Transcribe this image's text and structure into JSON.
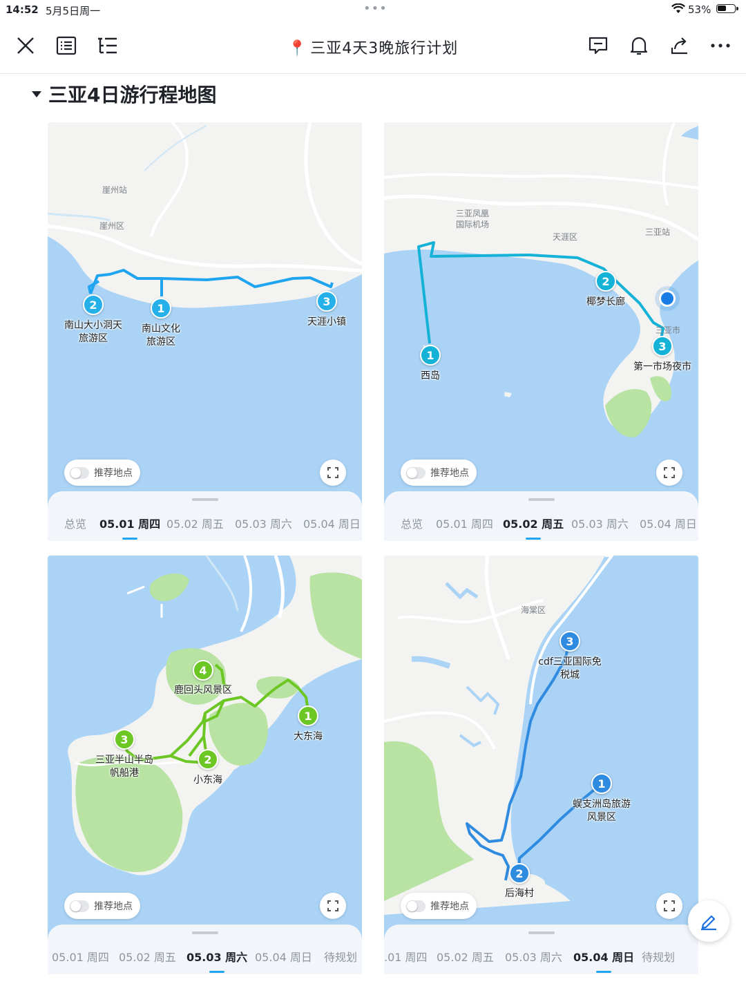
{
  "status_bar": {
    "time": "14:52",
    "date": "5月5日周一",
    "battery": "53%",
    "battery_level": 0.53
  },
  "toolbar": {
    "title": "三亚4天3晚旅行计划",
    "icons": [
      "close-icon",
      "outline-icon",
      "toc-icon",
      "comment-icon",
      "bell-icon",
      "share-icon",
      "more-icon"
    ]
  },
  "section": {
    "title": "三亚4日游行程地图"
  },
  "colors": {
    "water": "#aad3f5",
    "land": "#f3f3f1",
    "green": "#b8e3a2",
    "route_blue": "#25b0ea",
    "route_green": "#6cc623",
    "route_dblue": "#2f8be0",
    "accent": "#1fa5f0"
  },
  "maps": [
    {
      "recommend_label": "推荐地点",
      "tabs": [
        "总览",
        "05.01 周四",
        "05.02 周五",
        "05.03 周六",
        "05.04 周日"
      ],
      "active_tab": 1,
      "areas": [
        "崖州站",
        "崖州区"
      ],
      "markers": [
        {
          "num": "2",
          "name": "南山大小洞天\n旅游区"
        },
        {
          "num": "1",
          "name": "南山文化\n旅游区"
        },
        {
          "num": "3",
          "name": "天涯小镇"
        }
      ]
    },
    {
      "recommend_label": "推荐地点",
      "tabs": [
        "总览",
        "05.01 周四",
        "05.02 周五",
        "05.03 周六",
        "05.04 周日"
      ],
      "active_tab": 2,
      "areas": [
        "三亚凤凰\n国际机场",
        "天涯区",
        "三亚站",
        "三亚市"
      ],
      "markers": [
        {
          "num": "1",
          "name": "西岛"
        },
        {
          "num": "2",
          "name": "椰梦长廊"
        },
        {
          "num": "3",
          "name": "第一市场夜市"
        }
      ]
    },
    {
      "recommend_label": "推荐地点",
      "tabs": [
        "05.01 周四",
        "05.02 周五",
        "05.03 周六",
        "05.04 周日",
        "待规划"
      ],
      "active_tab": 2,
      "areas": [],
      "markers": [
        {
          "num": "4",
          "name": "鹿回头风景区"
        },
        {
          "num": "1",
          "name": "大东海"
        },
        {
          "num": "3",
          "name": "三亚半山半岛\n帆船港"
        },
        {
          "num": "2",
          "name": "小东海"
        }
      ]
    },
    {
      "recommend_label": "推荐地点",
      "tabs": [
        ".01 周四",
        "05.02 周五",
        "05.03 周六",
        "05.04 周日",
        "待规划"
      ],
      "active_tab": 3,
      "areas": [
        "海棠区"
      ],
      "markers": [
        {
          "num": "3",
          "name": "cdf三亚国际免\n税城"
        },
        {
          "num": "1",
          "name": "蜈支洲岛旅游\n风景区"
        },
        {
          "num": "2",
          "name": "后海村"
        }
      ]
    }
  ]
}
